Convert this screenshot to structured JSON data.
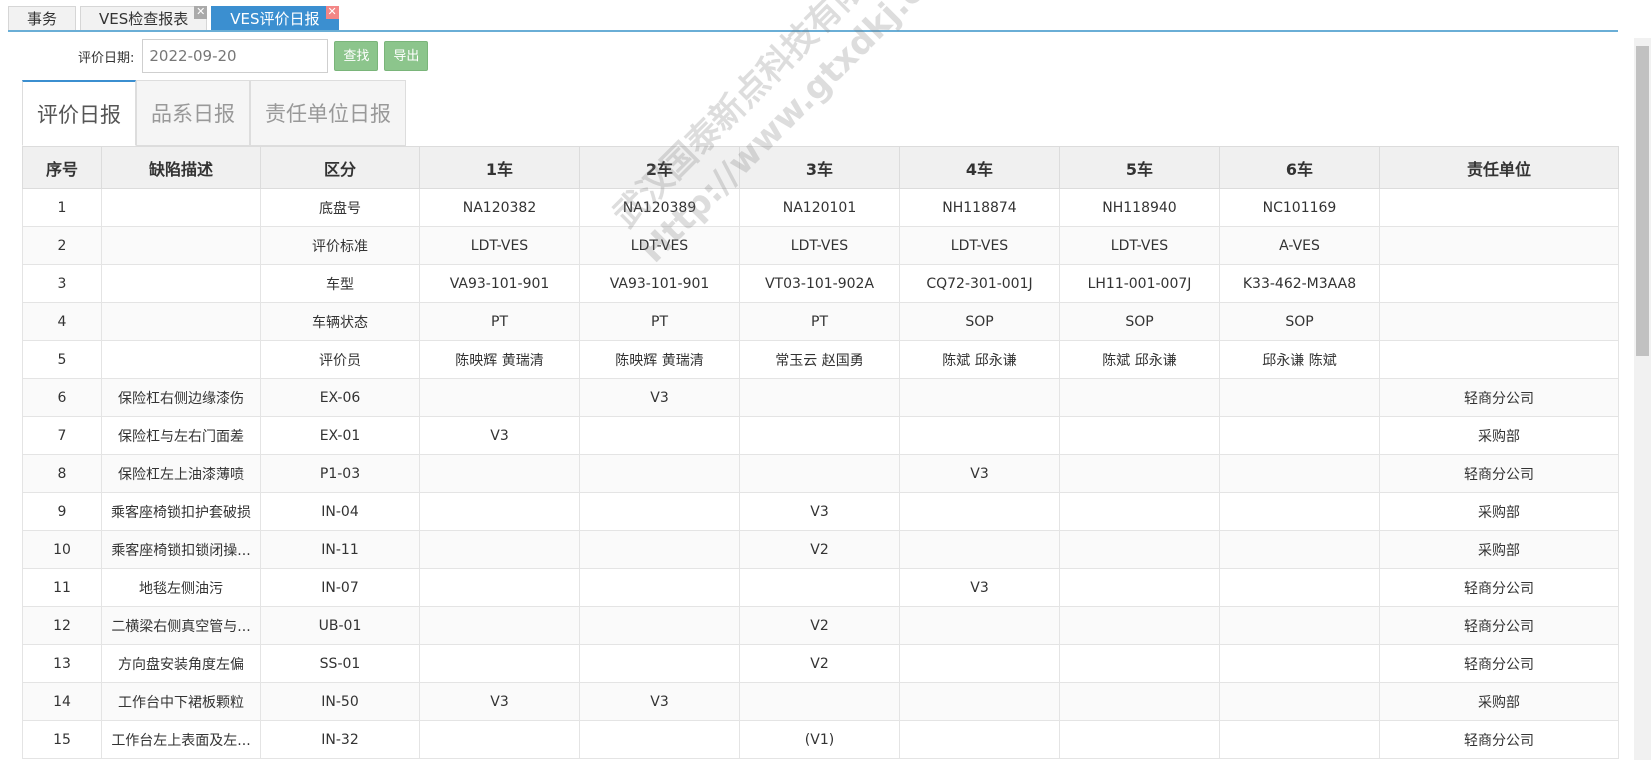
{
  "tabs": [
    {
      "label": "事务",
      "closable": false,
      "active": false
    },
    {
      "label": "VES检查报表",
      "closable": true,
      "active": false
    },
    {
      "label": "VES评价日报",
      "closable": true,
      "active": true
    }
  ],
  "filter": {
    "date_label": "评价日期:",
    "date_value": "2022-09-20",
    "search_btn": "查找",
    "export_btn": "导出"
  },
  "sub_tabs": [
    "评价日报",
    "品系日报",
    "责任单位日报"
  ],
  "table": {
    "headers": [
      "序号",
      "缺陷描述",
      "区分",
      "1车",
      "2车",
      "3车",
      "4车",
      "5车",
      "6车",
      "责任单位"
    ],
    "rows": [
      [
        "1",
        "",
        "底盘号",
        "NA120382",
        "NA120389",
        "NA120101",
        "NH118874",
        "NH118940",
        "NC101169",
        ""
      ],
      [
        "2",
        "",
        "评价标准",
        "LDT-VES",
        "LDT-VES",
        "LDT-VES",
        "LDT-VES",
        "LDT-VES",
        "A-VES",
        ""
      ],
      [
        "3",
        "",
        "车型",
        "VA93-101-901",
        "VA93-101-901",
        "VT03-101-902A",
        "CQ72-301-001J",
        "LH11-001-007J",
        "K33-462-M3AA8",
        ""
      ],
      [
        "4",
        "",
        "车辆状态",
        "PT",
        "PT",
        "PT",
        "SOP",
        "SOP",
        "SOP",
        ""
      ],
      [
        "5",
        "",
        "评价员",
        "陈映辉 黄瑞清",
        "陈映辉 黄瑞清",
        "常玉云 赵国勇",
        "陈斌 邱永谦",
        "陈斌 邱永谦",
        "邱永谦 陈斌",
        ""
      ],
      [
        "6",
        "保险杠右侧边缘漆伤",
        "EX-06",
        "",
        "V3",
        "",
        "",
        "",
        "",
        "轻商分公司"
      ],
      [
        "7",
        "保险杠与左右门面差",
        "EX-01",
        "V3",
        "",
        "",
        "",
        "",
        "",
        "采购部"
      ],
      [
        "8",
        "保险杠左上油漆薄喷",
        "P1-03",
        "",
        "",
        "",
        "V3",
        "",
        "",
        "轻商分公司"
      ],
      [
        "9",
        "乘客座椅锁扣护套破损",
        "IN-04",
        "",
        "",
        "V3",
        "",
        "",
        "",
        "采购部"
      ],
      [
        "10",
        "乘客座椅锁扣锁闭操...",
        "IN-11",
        "",
        "",
        "V2",
        "",
        "",
        "",
        "采购部"
      ],
      [
        "11",
        "地毯左侧油污",
        "IN-07",
        "",
        "",
        "",
        "V3",
        "",
        "",
        "轻商分公司"
      ],
      [
        "12",
        "二横梁右侧真空管与...",
        "UB-01",
        "",
        "",
        "V2",
        "",
        "",
        "",
        "轻商分公司"
      ],
      [
        "13",
        "方向盘安装角度左偏",
        "SS-01",
        "",
        "",
        "V2",
        "",
        "",
        "",
        "轻商分公司"
      ],
      [
        "14",
        "工作台中下裙板颗粒",
        "IN-50",
        "V3",
        "V3",
        "",
        "",
        "",
        "",
        "采购部"
      ],
      [
        "15",
        "工作台左上表面及左...",
        "IN-32",
        "",
        "",
        "(V1)",
        "",
        "",
        "",
        "轻商分公司"
      ]
    ]
  },
  "watermark": {
    "line1": "武汉国泰新点科技有限公司",
    "line2": "Http://www.gtxdkj.com"
  }
}
